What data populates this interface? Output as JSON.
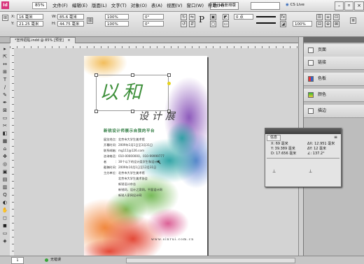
{
  "menubar": {
    "app_logo": "Id",
    "zoom": "85%",
    "items": [
      "文件(F)",
      "编辑(E)",
      "版面(L)",
      "文字(T)",
      "对象(O)",
      "表(A)",
      "视图(V)",
      "窗口(W)",
      "帮助(H)"
    ],
    "workspace": "设计画册排版",
    "cs_live": "CS Live",
    "colors": {
      "accent": "#2a63b8"
    }
  },
  "control_bar": {
    "x_label": "X:",
    "x_value": "16 毫米",
    "y_label": "Y:",
    "y_value": "21.25 毫米",
    "w_label": "W:",
    "w_value": "85.6 毫米",
    "h_label": "H:",
    "h_value": "44.75 毫米",
    "scale_x": "100%",
    "scale_y": "100%",
    "rotate": "0°",
    "shear": "0°",
    "stroke_weight": "0 点",
    "percent": "100%"
  },
  "document_tab": {
    "title": "*宣传招贴.indd @ 85% [预览]",
    "close": "×"
  },
  "tools": [
    "▸",
    "⇱",
    "↔",
    "⊞",
    "T",
    "∕",
    "✎",
    "✒",
    "⊠",
    "▭",
    "✂",
    "◧",
    "▦",
    "⌂",
    "✥",
    "◎",
    "▣",
    "▤",
    "▥",
    "Q",
    "◐",
    "✋",
    "◻",
    "◼",
    "▭",
    "◈"
  ],
  "poster": {
    "title_calligraphy": "以和",
    "title_sub": "设计展",
    "tagline": "新锐设计师展示自我的平台",
    "info_lines": [
      "展览地点：北京市大学生美术馆",
      "开幕时间：2009年1月1日至3月31日",
      "联系邮箱：mg111@126.com",
      "咨询电话：010-00000000，010-99999777",
      "者　　　：30个以下的设计类学生和设计师",
      "截稿时间：2009年10月1日至12月31日",
      "主办单位：北京市大学生美术馆",
      "　　　　　北京市大学生美术协会",
      "　　　　　新锐设计杂志",
      "　　　　　新锐网，设计之家网，平面设计网",
      "　　　　　新锐人家网设计网"
    ],
    "website": "www.sinrui.com.cn"
  },
  "right_panels": [
    {
      "label": "页面",
      "icon": "pages-icon"
    },
    {
      "label": "链接",
      "icon": "links-icon"
    },
    {
      "label": "色板",
      "icon": "swatches-icon"
    },
    {
      "label": "颜色",
      "icon": "color-icon"
    },
    {
      "label": "描边",
      "icon": "stroke-icon"
    }
  ],
  "info_panel": {
    "title": "信息",
    "x": "X: 69 毫米",
    "y": "Y: 39.389 毫米",
    "d": "D: 17.656 毫米",
    "dx": "ΔX: 12.951 毫米",
    "dy": "ΔY: 12 毫米",
    "angle": "∠: 137.2°"
  },
  "status": {
    "page": "1",
    "state": "无错误"
  }
}
